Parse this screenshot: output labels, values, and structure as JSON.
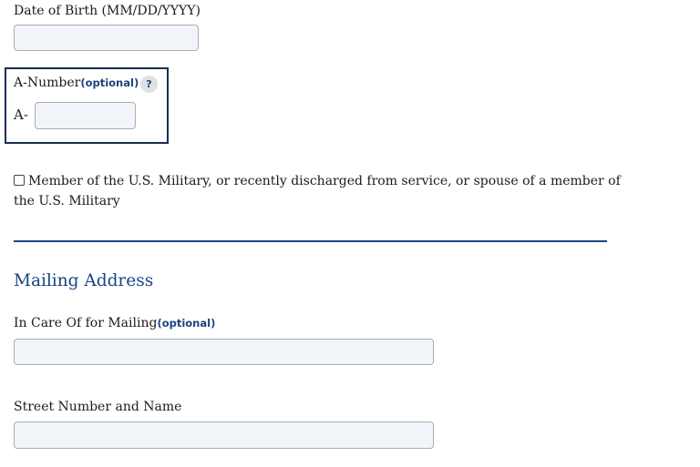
{
  "dob": {
    "label": "Date of Birth (MM/DD/YYYY)",
    "value": "",
    "placeholder": ""
  },
  "a_number": {
    "label": "A-Number",
    "optional_tag": "(optional)",
    "help_text": "?",
    "prefix": "A-",
    "value": ""
  },
  "military": {
    "checked": false,
    "label": "Member of the U.S. Military, or recently discharged from service, or spouse of a member of the U.S. Military"
  },
  "mailing_address": {
    "title": "Mailing Address",
    "in_care_of": {
      "label": "In Care Of for Mailing",
      "optional_tag": "(optional)",
      "value": ""
    },
    "street": {
      "label": "Street Number and Name",
      "value": ""
    }
  },
  "colors": {
    "accent": "#1a4480",
    "box_border": "#162e51",
    "input_bg": "#f1f4f8",
    "input_border": "#a9aeb1"
  },
  "icons": {
    "help": "help-icon",
    "checkbox": "checkbox-icon"
  }
}
